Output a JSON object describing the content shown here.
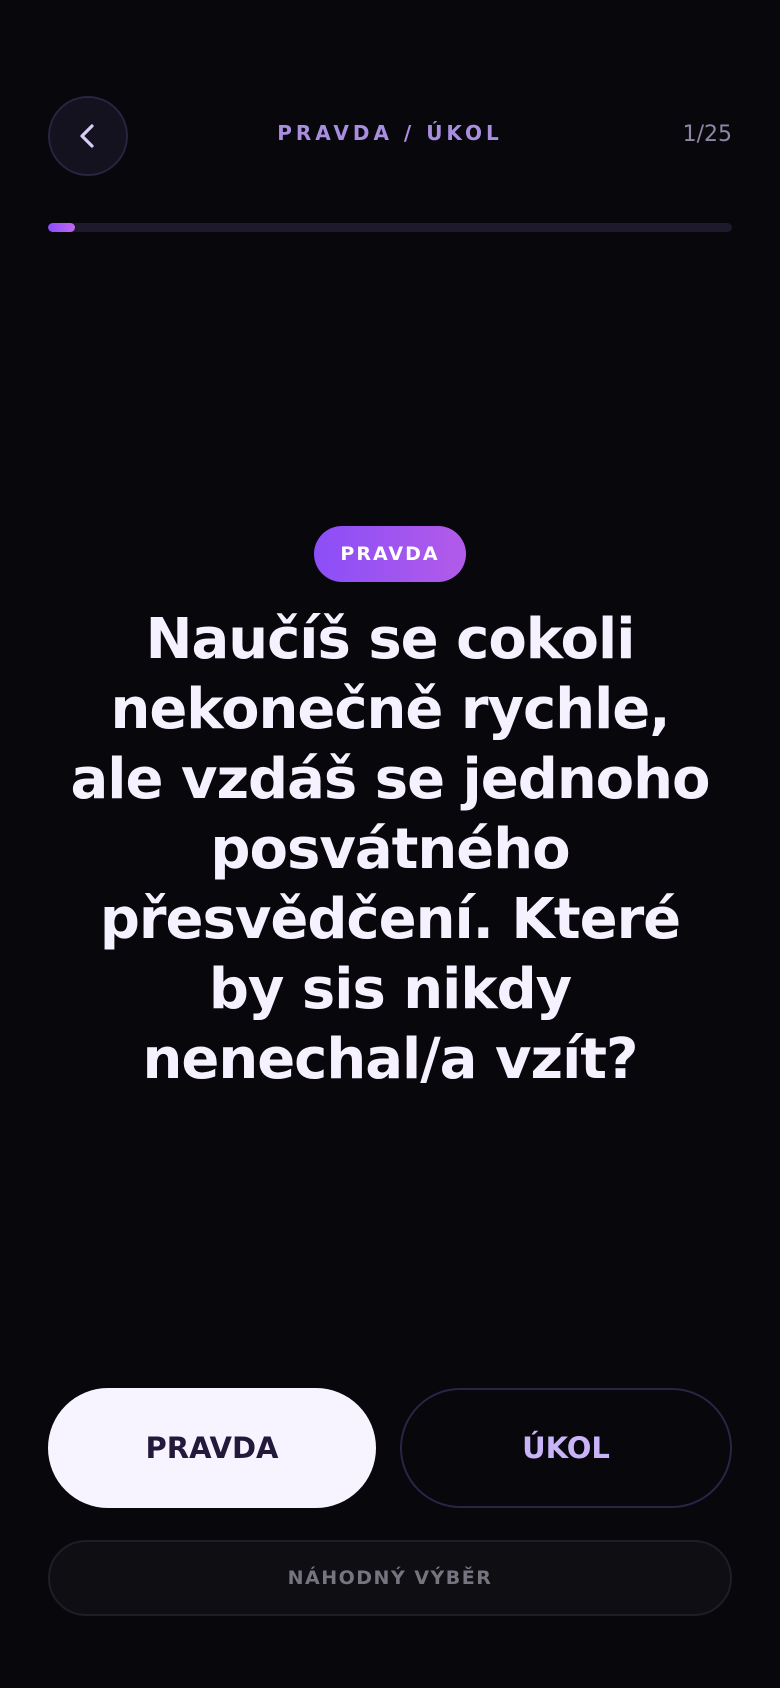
{
  "header": {
    "back_icon": "chevron-left-icon",
    "title": "PRAVDA / ÚKOL",
    "counter": "1/25"
  },
  "progress": {
    "current": 1,
    "total": 25,
    "fraction": 0.04
  },
  "card": {
    "badge": "PRAVDA",
    "question": "Naučíš se cokoli nekonečně rychle, ale vzdáš se jednoho posvátného přesvědčení. Které by sis nikdy nenechal/a vzít?"
  },
  "actions": {
    "truth_label": "PRAVDA",
    "dare_label": "ÚKOL",
    "random_label": "NÁHODNÝ VÝBĚR"
  },
  "colors": {
    "background": "#07070c",
    "accent": "#9b55f0",
    "header_text": "#a98ee0",
    "question_text": "#f6f1ff"
  }
}
